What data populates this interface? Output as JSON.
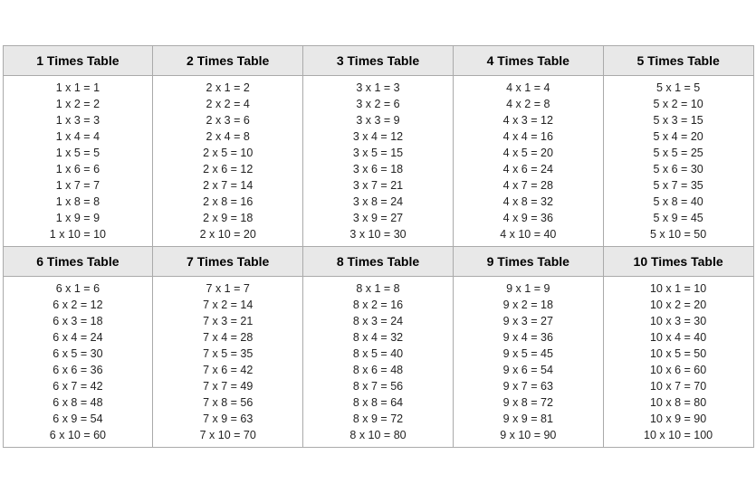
{
  "tables": [
    {
      "id": 1,
      "header": "1 Times Table",
      "rows": [
        "1 x 1 = 1",
        "1 x 2 = 2",
        "1 x 3 = 3",
        "1 x 4 = 4",
        "1 x 5 = 5",
        "1 x 6 = 6",
        "1 x 7 = 7",
        "1 x 8 = 8",
        "1 x 9 = 9",
        "1 x 10 = 10"
      ]
    },
    {
      "id": 2,
      "header": "2 Times Table",
      "rows": [
        "2 x 1 = 2",
        "2 x 2 = 4",
        "2 x 3 = 6",
        "2 x 4 = 8",
        "2 x 5 = 10",
        "2 x 6 = 12",
        "2 x 7 = 14",
        "2 x 8 = 16",
        "2 x 9 = 18",
        "2 x 10 = 20"
      ]
    },
    {
      "id": 3,
      "header": "3 Times Table",
      "rows": [
        "3 x 1 = 3",
        "3 x 2 = 6",
        "3 x 3 = 9",
        "3 x 4 = 12",
        "3 x 5 = 15",
        "3 x 6 = 18",
        "3 x 7 = 21",
        "3 x 8 = 24",
        "3 x 9 = 27",
        "3 x 10 = 30"
      ]
    },
    {
      "id": 4,
      "header": "4 Times Table",
      "rows": [
        "4 x 1 = 4",
        "4 x 2 = 8",
        "4 x 3 = 12",
        "4 x 4 = 16",
        "4 x 5 = 20",
        "4 x 6 = 24",
        "4 x 7 = 28",
        "4 x 8 = 32",
        "4 x 9 = 36",
        "4 x 10 = 40"
      ]
    },
    {
      "id": 5,
      "header": "5 Times Table",
      "rows": [
        "5 x 1 = 5",
        "5 x 2 = 10",
        "5 x 3 = 15",
        "5 x 4 = 20",
        "5 x 5 = 25",
        "5 x 6 = 30",
        "5 x 7 = 35",
        "5 x 8 = 40",
        "5 x 9 = 45",
        "5 x 10 = 50"
      ]
    },
    {
      "id": 6,
      "header": "6 Times Table",
      "rows": [
        "6 x 1 = 6",
        "6 x 2 = 12",
        "6 x 3 = 18",
        "6 x 4 = 24",
        "6 x 5 = 30",
        "6 x 6 = 36",
        "6 x 7 = 42",
        "6 x 8 = 48",
        "6 x 9 = 54",
        "6 x 10 = 60"
      ]
    },
    {
      "id": 7,
      "header": "7 Times Table",
      "rows": [
        "7 x 1 = 7",
        "7 x 2 = 14",
        "7 x 3 = 21",
        "7 x 4 = 28",
        "7 x 5 = 35",
        "7 x 6 = 42",
        "7 x 7 = 49",
        "7 x 8 = 56",
        "7 x 9 = 63",
        "7 x 10 = 70"
      ]
    },
    {
      "id": 8,
      "header": "8 Times Table",
      "rows": [
        "8 x 1 = 8",
        "8 x 2 = 16",
        "8 x 3 = 24",
        "8 x 4 = 32",
        "8 x 5 = 40",
        "8 x 6 = 48",
        "8 x 7 = 56",
        "8 x 8 = 64",
        "8 x 9 = 72",
        "8 x 10 = 80"
      ]
    },
    {
      "id": 9,
      "header": "9 Times Table",
      "rows": [
        "9 x 1 = 9",
        "9 x 2 = 18",
        "9 x 3 = 27",
        "9 x 4 = 36",
        "9 x 5 = 45",
        "9 x 6 = 54",
        "9 x 7 = 63",
        "9 x 8 = 72",
        "9 x 9 = 81",
        "9 x 10 = 90"
      ]
    },
    {
      "id": 10,
      "header": "10 Times Table",
      "rows": [
        "10 x 1 = 10",
        "10 x 2 = 20",
        "10 x 3 = 30",
        "10 x 4 = 40",
        "10 x 5 = 50",
        "10 x 6 = 60",
        "10 x 7 = 70",
        "10 x 8 = 80",
        "10 x 9 = 90",
        "10 x 10 = 100"
      ]
    }
  ]
}
